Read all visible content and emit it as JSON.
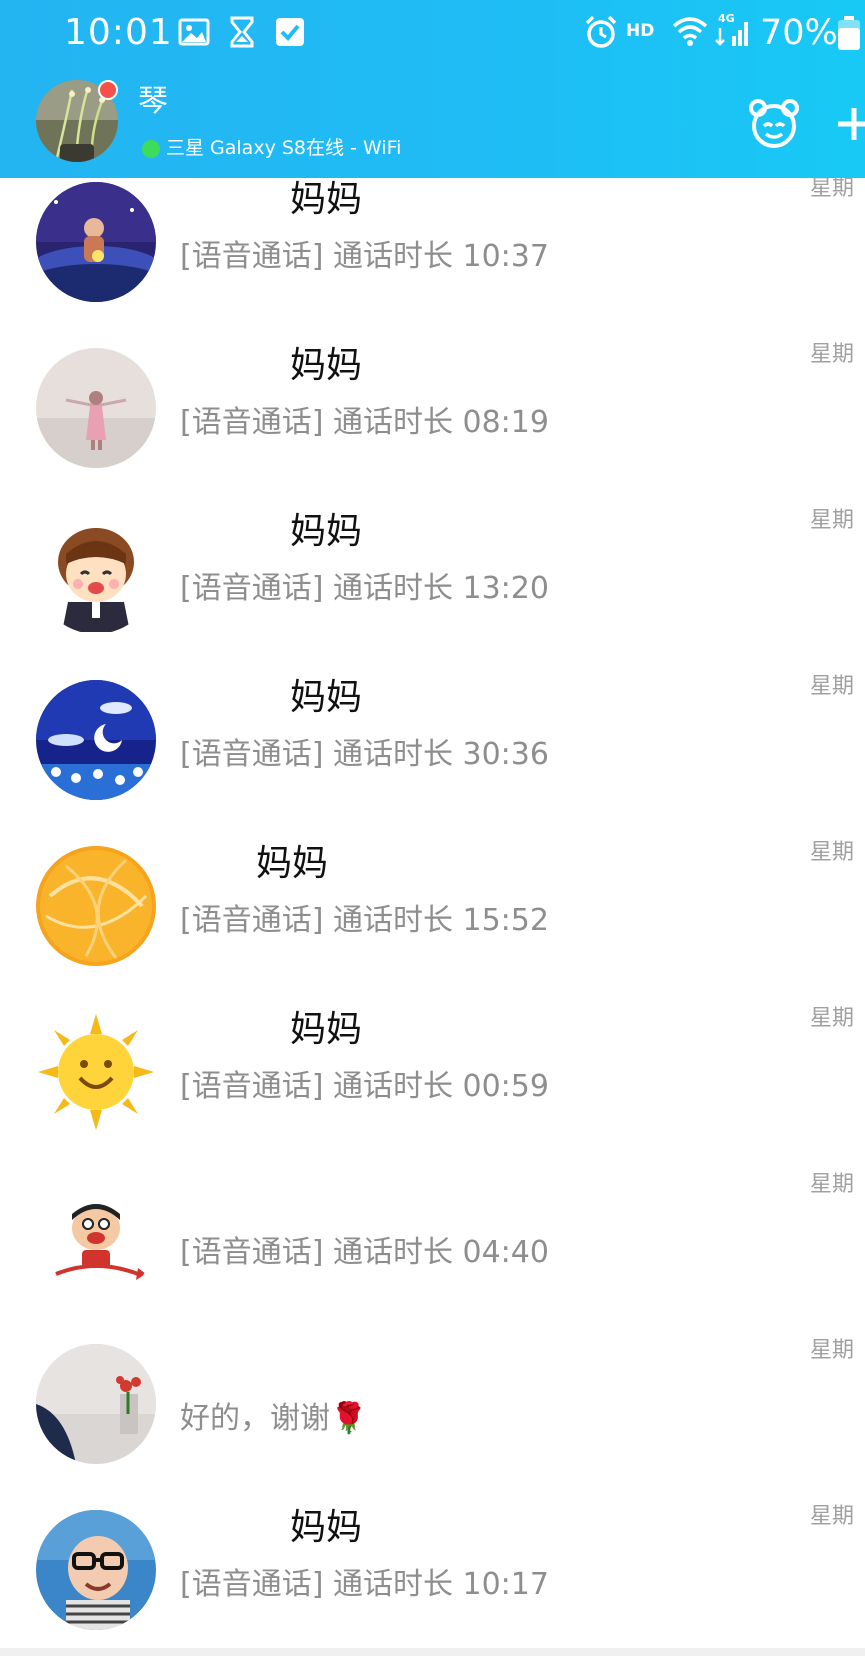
{
  "status_bar": {
    "time": "10:01",
    "hd_label": "HD",
    "network_label": "4G",
    "battery_percent": "70%",
    "icons": [
      "gallery-icon",
      "hourglass-icon",
      "check-icon",
      "alarm-icon",
      "wifi-icon",
      "signal-icon",
      "battery-icon"
    ]
  },
  "header": {
    "profile_name": "琴",
    "online_status": "三星 Galaxy S8在线 - WiFi",
    "has_unread_dot": true,
    "actions": [
      "companion-face-icon",
      "plus-icon"
    ]
  },
  "colors": {
    "header_bg": "#1fbcf5",
    "online_dot": "#3ddc5a",
    "unread_dot": "#f5514a",
    "name_text": "#111111",
    "message_text": "#8e8e8e",
    "time_text": "#a0a0a0"
  },
  "conversations": [
    {
      "name": "妈妈",
      "message": "[语音通话] 通话时长 10:37",
      "time": "星期",
      "avatar": "night-girl-avatar"
    },
    {
      "name": "妈妈",
      "message": "[语音通话] 通话时长 08:19",
      "time": "星期",
      "avatar": "girl-in-field-avatar"
    },
    {
      "name": "妈妈",
      "message": "[语音通话] 通话时长 13:20",
      "time": "星期",
      "avatar": "cartoon-boy-avatar"
    },
    {
      "name": "妈妈",
      "message": "[语音通话] 通话时长 30:36",
      "time": "星期",
      "avatar": "night-sky-avatar"
    },
    {
      "name": "妈妈",
      "message": "[语音通话] 通话时长 15:52",
      "time": "星期",
      "avatar": "orange-swirl-avatar"
    },
    {
      "name": "妈妈",
      "message": "[语音通话] 通话时长 00:59",
      "time": "星期",
      "avatar": "sun-avatar"
    },
    {
      "name": "",
      "message": "[语音通话] 通话时长 04:40",
      "time": "星期",
      "avatar": "wangzai-avatar"
    },
    {
      "name": "",
      "message": "好的，谢谢🌹",
      "time": "星期",
      "avatar": "flowers-photo-avatar"
    },
    {
      "name": "妈妈",
      "message": "[语音通话] 通话时长 10:17",
      "time": "星期",
      "avatar": "baby-glasses-avatar"
    }
  ]
}
